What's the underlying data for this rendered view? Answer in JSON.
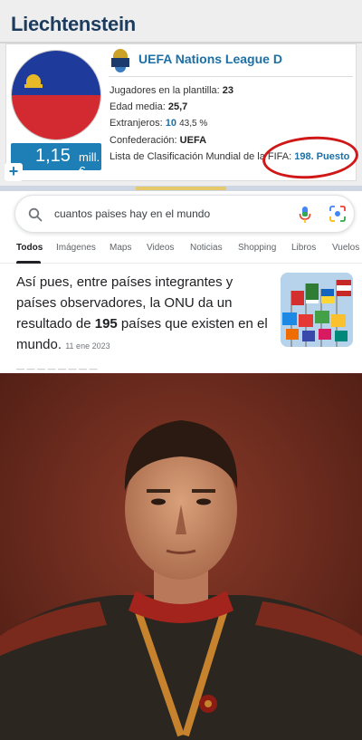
{
  "team_card": {
    "title": "Liechtenstein",
    "market_value": {
      "amount": "1,15",
      "unit": "mill. €"
    },
    "plus_label": "+",
    "league": "UEFA Nations League D",
    "stats": {
      "squad_label": "Jugadores en la plantilla:",
      "squad_value": "23",
      "age_label": "Edad media:",
      "age_value": "25,7",
      "foreign_label": "Extranjeros:",
      "foreign_value": "10",
      "foreign_pct": "43,5 %",
      "confed_label": "Confederación:",
      "confed_value": "UEFA",
      "fifa_label": "Lista de Clasificación Mundial de la FIFA:",
      "fifa_value": "198. Puesto"
    },
    "colors": {
      "title": "#1d3b5c",
      "accent": "#1d7fb6",
      "highlight_ring": "#d01818"
    },
    "flag": {
      "top": "#1e3a9a",
      "bottom": "#d22a30",
      "crown": "#e7b928"
    }
  },
  "google": {
    "query": "cuantos paises hay en el mundo",
    "tabs": [
      "Todos",
      "Imágenes",
      "Maps",
      "Videos",
      "Noticias",
      "Shopping",
      "Libros",
      "Vuelos"
    ],
    "active_tab": "Todos",
    "snippet": {
      "before": "Así pues, entre países integrantes y países observadores, la ONU da un resultado de ",
      "number": "195",
      "after": " países que existen en el mundo.",
      "date": "11 ene 2023"
    },
    "icons": [
      "search-icon",
      "microphone-icon",
      "google-lens-icon"
    ],
    "colors": {
      "blue": "#4285f4",
      "red": "#ea4335",
      "yellow": "#fbbc05",
      "green": "#34a853"
    }
  },
  "portrait": {
    "subject": "man in dark military dress uniform with gold braid",
    "colors": {
      "background": "#6b2a1e",
      "uniform": "#2b2620",
      "collar": "#a3241c",
      "braid": "#c7822d"
    }
  }
}
